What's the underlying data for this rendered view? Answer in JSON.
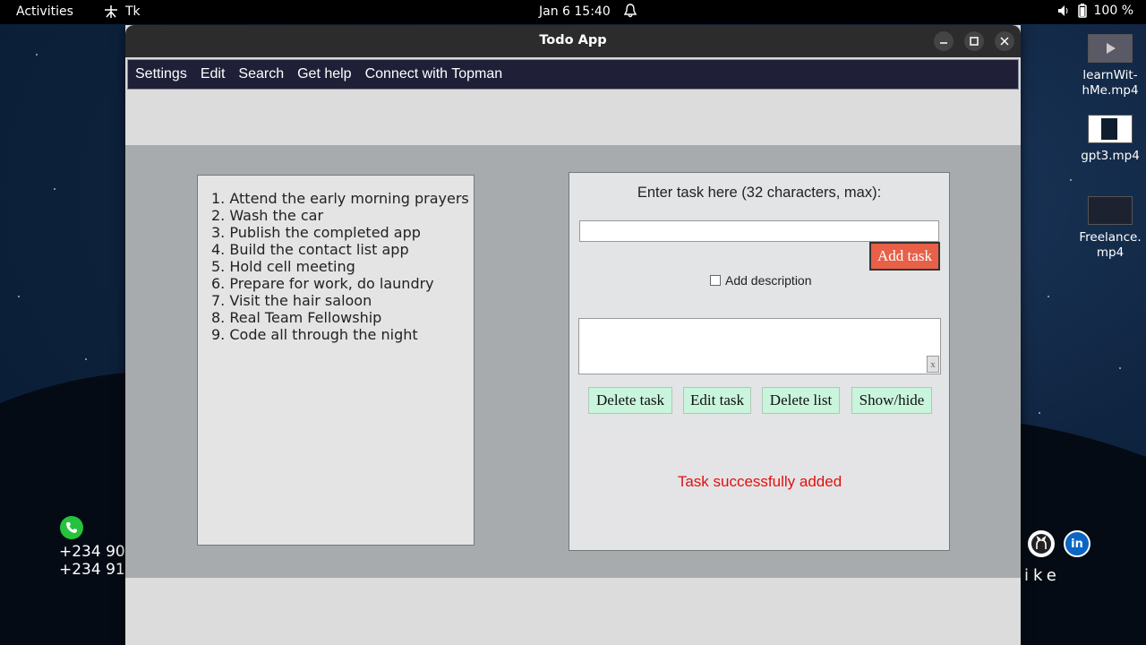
{
  "topbar": {
    "activities": "Activities",
    "app_indicator": "Tk",
    "clock": "Jan 6  15:40",
    "battery": "100 %"
  },
  "desktop": {
    "files": [
      {
        "name": "learnWit-\nhMe.mp4"
      },
      {
        "name": "gpt3.mp4"
      },
      {
        "name": "Freelance.\nmp4"
      }
    ],
    "contact_lines": [
      "+234 90",
      "+234 91"
    ],
    "social_icons": [
      "github-icon",
      "linkedin-icon"
    ],
    "wallpaper_text": "ike"
  },
  "window": {
    "title": "Todo App",
    "menu": [
      "Settings",
      "Edit",
      "Search",
      "Get help",
      "Connect with Topman"
    ]
  },
  "tasks": [
    "1. Attend the early morning prayers",
    "2. Wash the car",
    "3. Publish the completed app",
    "4. Build the contact list app",
    "5. Hold cell meeting",
    "6. Prepare for work, do laundry",
    "7. Visit the hair saloon",
    "8. Real Team Fellowship",
    "9. Code all through the night"
  ],
  "form": {
    "prompt": "Enter task here (32 characters, max):",
    "task_value": "",
    "add_button": "Add task",
    "description_label": "Add description",
    "description_checked": false,
    "description_value": "",
    "clear_label": "x"
  },
  "actions": {
    "delete_task": "Delete task",
    "edit_task": "Edit task",
    "delete_list": "Delete list",
    "show_hide": "Show/hide"
  },
  "status": {
    "message": "Task successfully added",
    "color": "#e01010"
  },
  "colors": {
    "menubar": "#1f2038",
    "add_button": "#e86048",
    "action_buttons": "#c8f5dc"
  }
}
